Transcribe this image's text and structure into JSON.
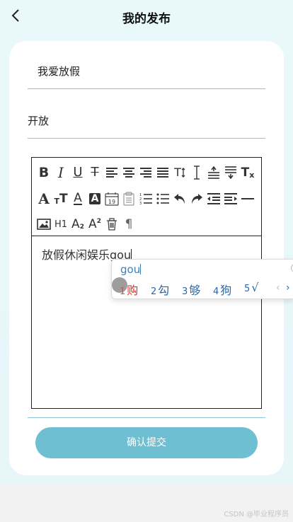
{
  "header": {
    "title": "我的发布",
    "back_icon": "chevron-left-icon"
  },
  "form": {
    "title_value": "我爱放假",
    "category_value": "开放",
    "editor_content": "放假休闲娱乐gou",
    "editor_toolbar": [
      "bold-icon",
      "italic-icon",
      "underline-icon",
      "strikethrough-icon",
      "align-left-icon",
      "align-center-icon",
      "align-right-icon",
      "align-justify-icon",
      "text-size-icon",
      "line-height-icon",
      "paragraph-spacing-top-icon",
      "paragraph-spacing-bottom-icon",
      "clear-format-icon",
      "font-family-icon",
      "font-size-icon",
      "font-color-icon",
      "background-color-icon",
      "date-icon",
      "clipboard-icon",
      "ordered-list-icon",
      "unordered-list-icon",
      "undo-icon",
      "redo-icon",
      "outdent-icon",
      "indent-icon",
      "horizontal-rule-icon",
      "image-icon",
      "heading-icon",
      "subscript-icon",
      "superscript-icon",
      "delete-icon",
      "paragraph-mark-icon"
    ],
    "submit_label": "确认提交"
  },
  "toolbar_labels": {
    "bold": "B",
    "italic": "I",
    "underline": "U",
    "strike": "T",
    "text_size": "T",
    "font_family": "A",
    "font_size": "T",
    "font_color": "A",
    "bg_color": "A",
    "date": "19",
    "heading": "H1",
    "sub_a": "A",
    "sub_2": "2",
    "sup_a": "A",
    "sup_2": "2",
    "pilcrow": "¶",
    "clear": "T",
    "clear_x": "x"
  },
  "ime": {
    "input": "gou",
    "candidates": [
      {
        "num": "1",
        "word": "购"
      },
      {
        "num": "2",
        "word": "勾"
      },
      {
        "num": "3",
        "word": "够"
      },
      {
        "num": "4",
        "word": "狗"
      },
      {
        "num": "5",
        "word": "√"
      }
    ],
    "prev": "‹",
    "next": "›"
  },
  "watermark": "CSDN @毕业程序员",
  "colors": {
    "accent": "#6fbfd2",
    "divider": "#8cc7d6",
    "background": "#e8f7fa"
  }
}
